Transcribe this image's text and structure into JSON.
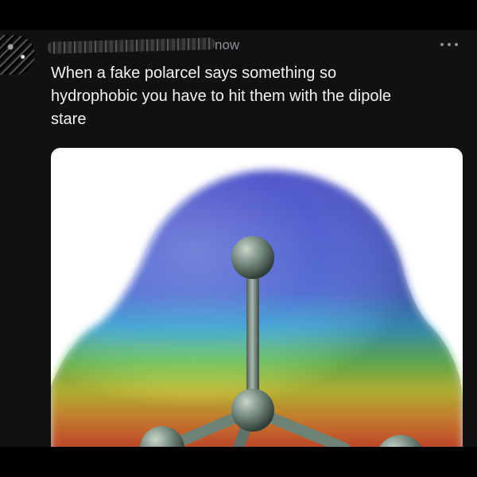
{
  "post": {
    "timestamp": "now",
    "text": "When a fake polarcel says something so\nhydrophobic you have to hit them with the dipole\nstare"
  },
  "icons": {
    "more": "more-horizontal-icon"
  },
  "colors": {
    "background": "#000000",
    "post_background": "#111113",
    "text": "#f2f2f2",
    "secondary_text": "#8e8e93",
    "potential_map_blue": "#4a56c8",
    "potential_map_red": "#e2302c"
  }
}
